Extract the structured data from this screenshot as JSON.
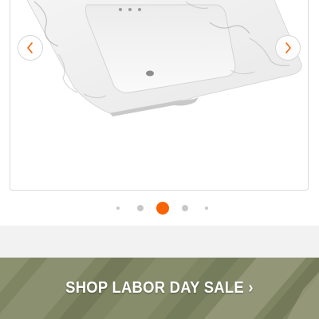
{
  "gallery": {
    "image_icon": "marble-vanity-sink-image",
    "prev_icon": "chevron-left-icon",
    "next_icon": "chevron-right-icon",
    "slide_count": 5,
    "active_slide": 3,
    "colors": {
      "active_dot": "#f96302",
      "inactive_dot": "#c8c8c8",
      "arrow_stroke": "#f96302"
    }
  },
  "banner": {
    "label": "SHOP LABOR DAY SALE",
    "chevron": "›",
    "background": "#7f8563"
  }
}
